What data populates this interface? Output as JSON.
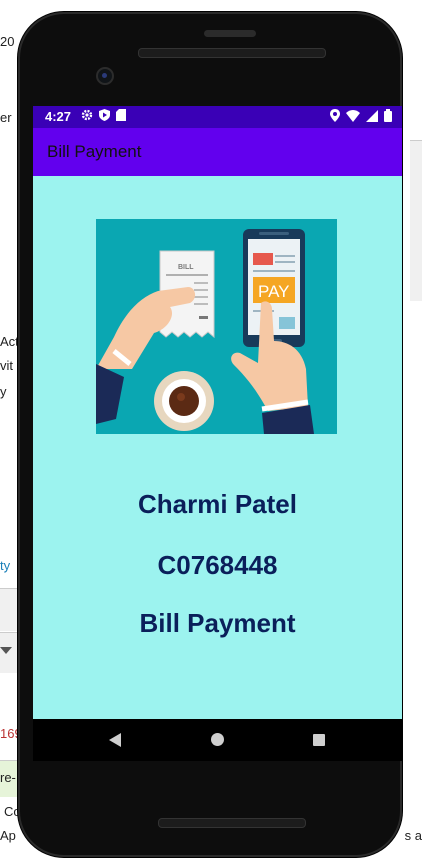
{
  "background": {
    "left_fragments": [
      "20",
      "er",
      "Act",
      "vit",
      "y",
      "ty",
      "169",
      "re-",
      "Co",
      "Ap"
    ],
    "right_fragments": [
      "s a"
    ]
  },
  "status_bar": {
    "time": "4:27",
    "left_icons": [
      "gear-icon",
      "shield-icon",
      "sd-card-icon"
    ],
    "right_icons": [
      "location-icon",
      "wifi-icon",
      "signal-icon",
      "battery-icon"
    ],
    "color": "#3a00b6"
  },
  "app_bar": {
    "title": "Bill Payment",
    "color": "#6200ee"
  },
  "content": {
    "background": "#9cf3ef",
    "image_label_bill": "BILL",
    "image_label_pay": "PAY",
    "name": "Charmi Patel",
    "student_id": "C0768448",
    "subtitle": "Bill Payment"
  },
  "nav_bar": {
    "icons": [
      "back-icon",
      "home-icon",
      "recents-icon"
    ]
  }
}
